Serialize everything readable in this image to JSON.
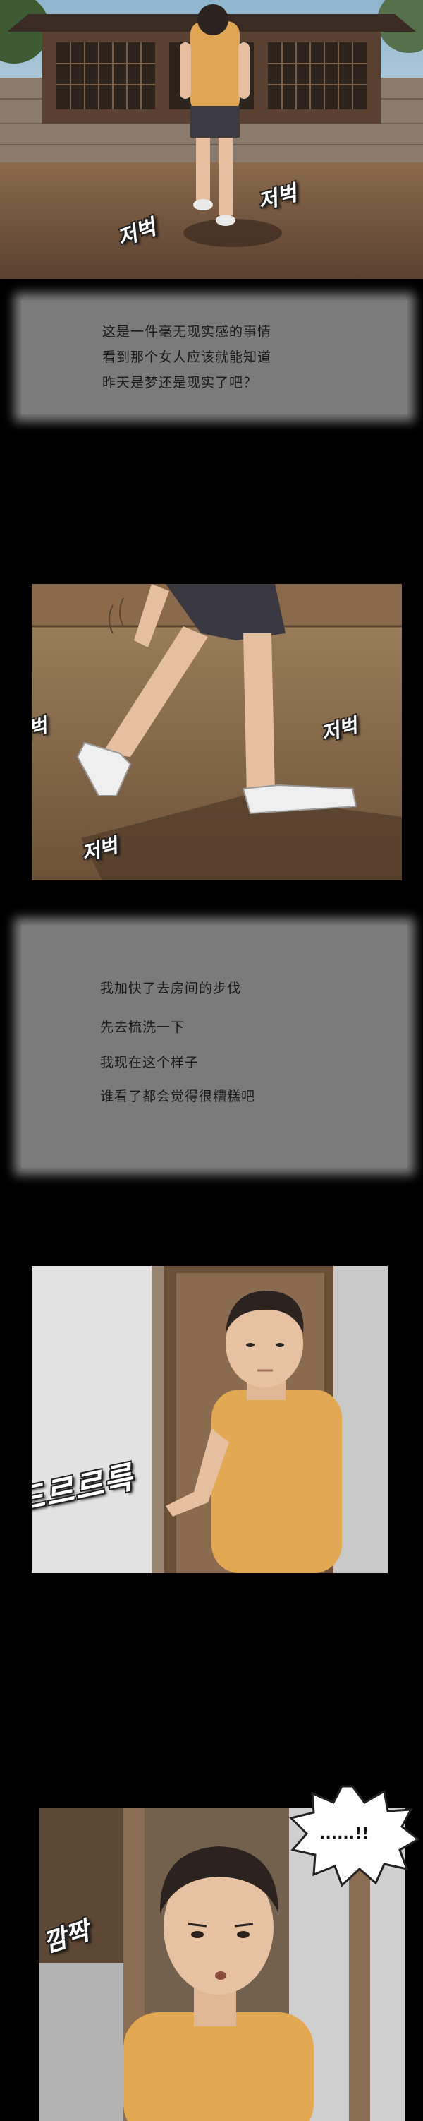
{
  "captions": {
    "box1": [
      "这是一件毫无现实感的事情",
      "看到那个女人应该就能知道",
      "昨天是梦还是现实了吧？"
    ],
    "box2": [
      "我加快了去房间的步伐",
      "先去梳洗一下",
      "我现在这个样子",
      "谁看了都会觉得很糟糕吧"
    ]
  },
  "sfx": {
    "step1a": "저벅",
    "step1b": "저벅",
    "step2a": "저벅",
    "step2b": "저벅",
    "step2c": "저벅",
    "door": "드르르륵",
    "startle": "깜짝"
  },
  "bubble": {
    "text": "......!!"
  }
}
